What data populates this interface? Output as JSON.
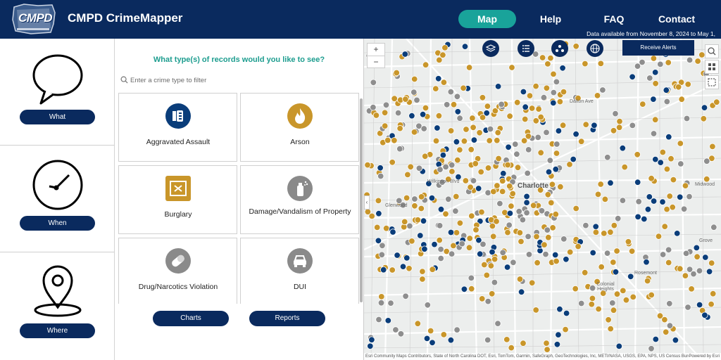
{
  "header": {
    "logo_text": "CMPD",
    "title": "CMPD CrimeMapper",
    "nav": [
      {
        "label": "Map",
        "active": true
      },
      {
        "label": "Help",
        "active": false
      },
      {
        "label": "FAQ",
        "active": false
      },
      {
        "label": "Contact",
        "active": false
      }
    ],
    "availability": "Data available from November 8, 2024  to May 1,"
  },
  "left_panel": {
    "what_label": "What",
    "when_label": "When",
    "where_label": "Where"
  },
  "records": {
    "question": "What type(s) of records would you like to see?",
    "filter_placeholder": "Enter a crime type to filter",
    "types": [
      {
        "label": "Aggravated Assault",
        "icon": "aggravated-assault-icon",
        "color": "#0a3d7a"
      },
      {
        "label": "Arson",
        "icon": "flame-icon",
        "color": "#c9962a"
      },
      {
        "label": "Burglary",
        "icon": "burglary-icon",
        "color": "#c9962a"
      },
      {
        "label": "Damage/Vandalism of Property",
        "icon": "spray-can-icon",
        "color": "#8a8a8a"
      },
      {
        "label": "Drug/Narcotics Violation",
        "icon": "pill-icon",
        "color": "#8a8a8a"
      },
      {
        "label": "DUI",
        "icon": "car-icon",
        "color": "#8a8a8a"
      }
    ],
    "charts_label": "Charts",
    "reports_label": "Reports"
  },
  "map": {
    "zoom_in": "+",
    "zoom_out": "−",
    "alerts_label": "Receive Alerts",
    "labels": {
      "dalton": "Dalton Ave",
      "wilkinson": "Wilkinson Blvd",
      "charlotte": "Charlotte",
      "glenwood": "Glenwood",
      "midwood": "Midwood",
      "grove": "Grove",
      "rosemont": "Rosemont",
      "colonial": "Colonial Heights"
    },
    "attribution": "Esri Community Maps Contributors, State of North Carolina DOT, Esri, TomTom, Garmin, SafeGraph, GeoTechnologies, Inc, METI/NASA, USGS, EPA, NPS, US Census Bureau, USDA, U...",
    "powered_by": "Powered by Esri",
    "colors": {
      "gold": "#c9962a",
      "navy": "#0a3d7a",
      "gray": "#8e8e8e"
    }
  }
}
